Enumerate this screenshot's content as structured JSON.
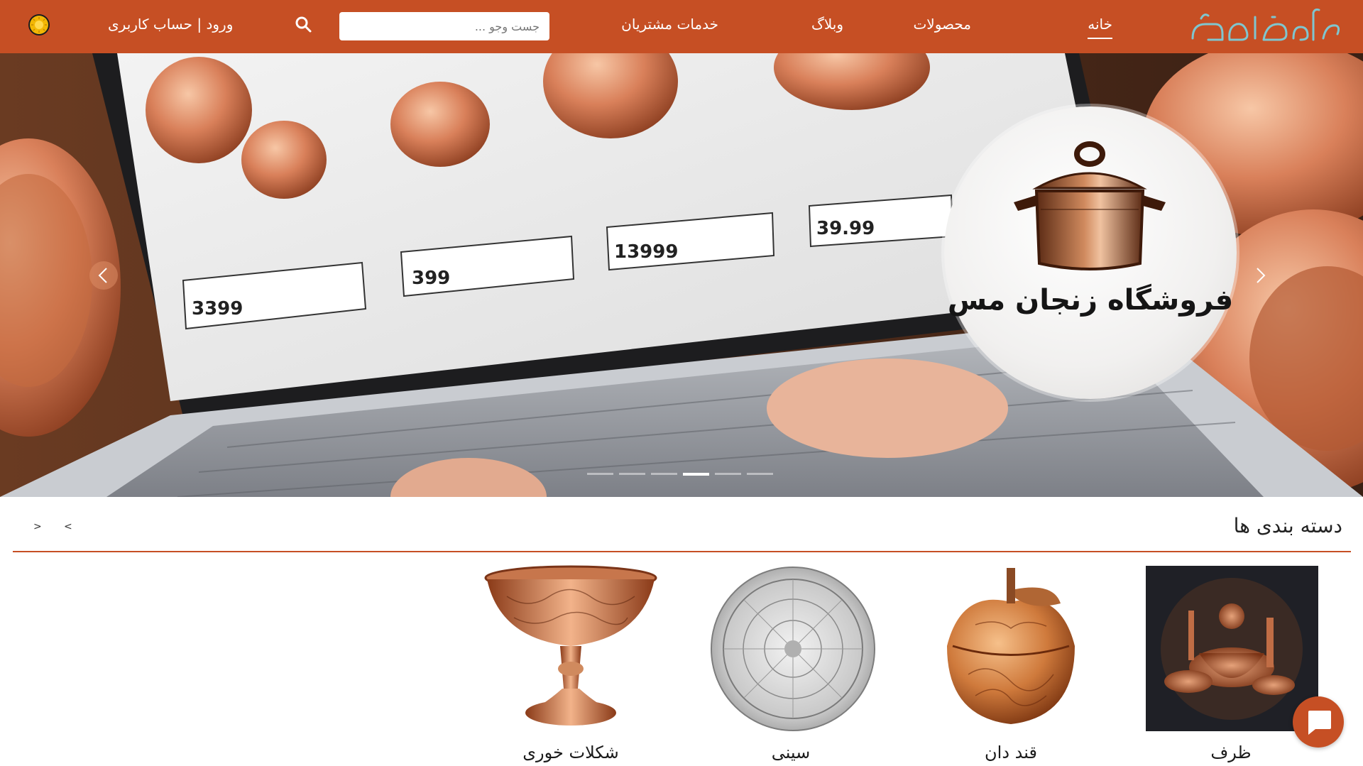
{
  "brand": {
    "logo_text": "زنجان مس",
    "accent": "#c64f24"
  },
  "nav": {
    "home": "خانه",
    "products": "محصولات",
    "blog": "وبلاگ",
    "services": "خدمات مشتریان",
    "login": "ورود | حساب کاربری"
  },
  "search": {
    "placeholder": "جست وجو ...",
    "icon": "search-icon"
  },
  "theme_toggle": {
    "icon": "sun-icon"
  },
  "hero": {
    "badge_title": "فروشگاه زنجان مس",
    "slide_count": 6,
    "active_slide": 4
  },
  "categories": {
    "title": "دسته بندی ها",
    "prev_label": "<",
    "next_label": ">",
    "items": [
      {
        "label": "ظرف",
        "icon": "copper-cookware-collage"
      },
      {
        "label": "قند دان",
        "icon": "copper-apple-sugar-bowl"
      },
      {
        "label": "سینی",
        "icon": "engraved-silver-tray"
      },
      {
        "label": "شکلات خوری",
        "icon": "copper-footed-bowl"
      }
    ]
  },
  "chat": {
    "icon": "chat-bubble-icon"
  }
}
